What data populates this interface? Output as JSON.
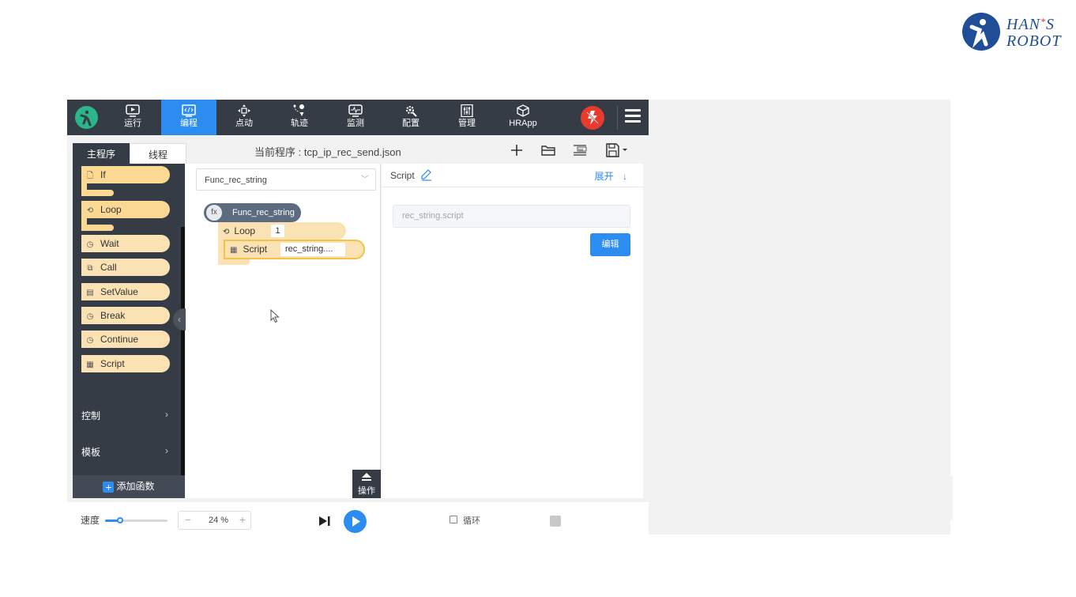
{
  "brand": {
    "line1": "HAN",
    "star": "*",
    "line1b": "S",
    "line2": "ROBOT"
  },
  "nav": {
    "items": [
      {
        "id": "run",
        "label": "运行",
        "icon": "play-screen-icon"
      },
      {
        "id": "program",
        "label": "编程",
        "icon": "code-icon",
        "active": true
      },
      {
        "id": "jog",
        "label": "点动",
        "icon": "move-arrows-icon"
      },
      {
        "id": "trajectory",
        "label": "轨迹",
        "icon": "path-pin-icon"
      },
      {
        "id": "monitor",
        "label": "监测",
        "icon": "monitor-icon"
      },
      {
        "id": "config",
        "label": "配置",
        "icon": "gear-wrench-icon"
      },
      {
        "id": "manage",
        "label": "管理",
        "icon": "panel-icon"
      },
      {
        "id": "hrapp",
        "label": "HRApp",
        "icon": "cube-icon"
      }
    ]
  },
  "tabs": {
    "main": "主程序",
    "thread": "线程"
  },
  "toolbar": {
    "current_program_label": "当前程序 : tcp_ip_rec_send.json"
  },
  "palette": {
    "blocks": [
      {
        "label": "If",
        "icon": "file-icon"
      },
      {
        "label": "Loop",
        "icon": "loop-icon"
      },
      {
        "label": "Wait",
        "icon": "clock-icon"
      },
      {
        "label": "Call",
        "icon": "link-icon"
      },
      {
        "label": "SetValue",
        "icon": "variable-icon"
      },
      {
        "label": "Break",
        "icon": "clock-icon"
      },
      {
        "label": "Continue",
        "icon": "clock-icon"
      },
      {
        "label": "Script",
        "icon": "script-icon"
      }
    ],
    "categories": [
      {
        "label": "控制"
      },
      {
        "label": "模板"
      }
    ],
    "add_function": "添加函数"
  },
  "canvas": {
    "function_select": "Func_rec_string",
    "fx_badge": "fx",
    "function_block": "Func_rec_string",
    "loop_label": "Loop",
    "loop_count": "1",
    "script_label": "Script",
    "script_value": "rec_string....",
    "operate_button": "操作"
  },
  "properties": {
    "title": "Script",
    "expand": "展开",
    "script_path_placeholder": "rec_string.script",
    "edit_button": "编辑"
  },
  "bottom": {
    "speed_label": "速度",
    "speed_percent": 24,
    "speed_display": "24 %",
    "loop_label": "循环",
    "loop_checked": false
  },
  "colors": {
    "accent": "#2d8cf0",
    "nav_bg": "#353c46",
    "block_fill": "#fbe2b4",
    "block_highlight": "#f5c343",
    "estop": "#e93a2e",
    "brand": "#1f4e96"
  }
}
